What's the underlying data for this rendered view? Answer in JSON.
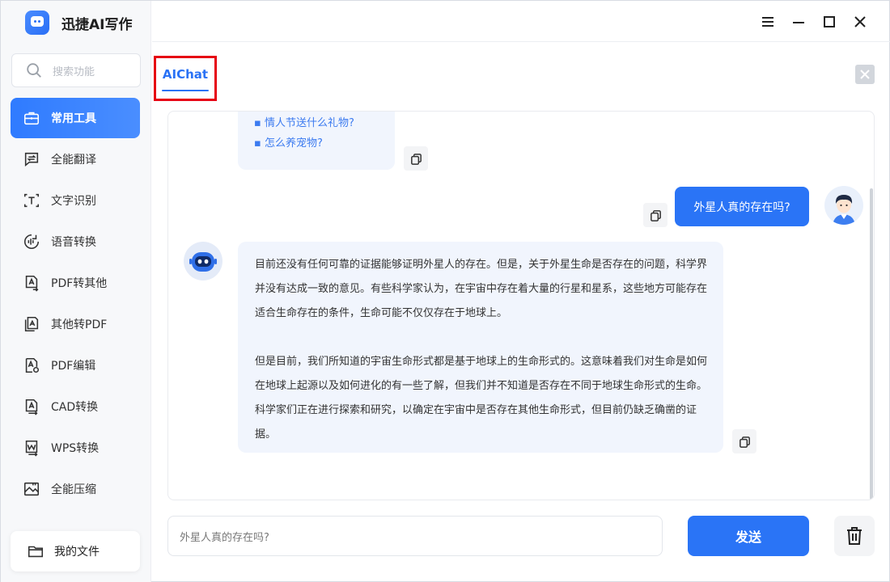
{
  "app": {
    "name": "迅捷AI写作"
  },
  "sidebar": {
    "search_placeholder": "搜索功能",
    "items": [
      {
        "label": "常用工具",
        "icon": "toolbox-icon",
        "active": true
      },
      {
        "label": "全能翻译",
        "icon": "translate-icon",
        "active": false
      },
      {
        "label": "文字识别",
        "icon": "text-recognition-icon",
        "active": false
      },
      {
        "label": "语音转换",
        "icon": "voice-convert-icon",
        "active": false
      },
      {
        "label": "PDF转其他",
        "icon": "pdf-convert-icon",
        "active": false
      },
      {
        "label": "其他转PDF",
        "icon": "to-pdf-icon",
        "active": false
      },
      {
        "label": "PDF编辑",
        "icon": "pdf-edit-icon",
        "active": false
      },
      {
        "label": "CAD转换",
        "icon": "cad-convert-icon",
        "active": false
      },
      {
        "label": "WPS转换",
        "icon": "wps-convert-icon",
        "active": false
      },
      {
        "label": "全能压缩",
        "icon": "compress-icon",
        "active": false
      }
    ],
    "my_files_label": "我的文件"
  },
  "tabs": [
    {
      "label": "AIChat",
      "active": true
    }
  ],
  "chat": {
    "suggestions": [
      "▪ 情人节送什么礼物?",
      "▪ 怎么养宠物?"
    ],
    "user_message": "外星人真的存在吗?",
    "bot_paragraphs": [
      "目前还没有任何可靠的证据能够证明外星人的存在。但是，关于外星生命是否存在的问题，科学界并没有达成一致的意见。有些科学家认为，在宇宙中存在着大量的行星和星系，这些地方可能存在适合生命存在的条件，生命可能不仅仅存在于地球上。",
      "但是目前，我们所知道的宇宙生命形式都是基于地球上的生命形式的。这意味着我们对生命是如何在地球上起源以及如何进化的有一些了解，但我们并不知道是否存在不同于地球生命形式的生命。科学家们正在进行探索和研究，以确定在宇宙中是否存在其他生命形式，但目前仍缺乏确凿的证据。"
    ]
  },
  "composer": {
    "input_value": "外星人真的存在吗?",
    "send_label": "发送"
  },
  "colors": {
    "accent": "#2a74f6",
    "highlight_border": "#e60012",
    "bubble_bg": "#f1f5fd"
  }
}
